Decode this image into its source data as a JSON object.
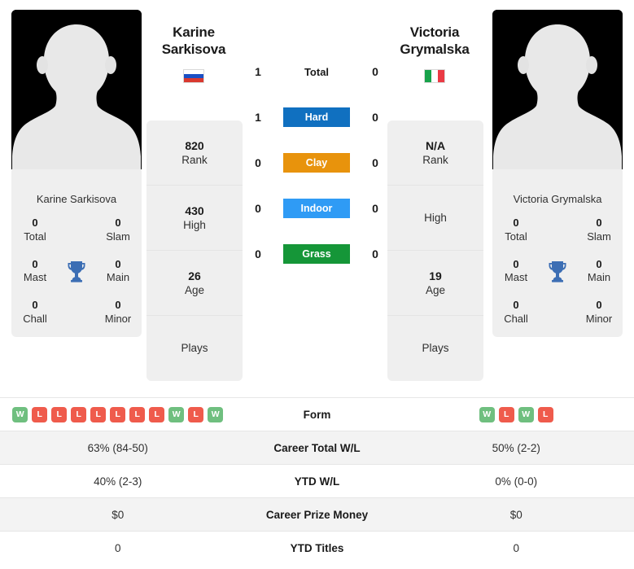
{
  "players": {
    "left": {
      "first_name": "Karine",
      "last_name": "Sarkisova",
      "full_name": "Karine Sarkisova",
      "flag": "ru-flag-icon",
      "avatar": "player-silhouette-icon",
      "rank": "820",
      "rank_label": "Rank",
      "high": "430",
      "high_label": "High",
      "age": "26",
      "age_label": "Age",
      "plays": "",
      "plays_label": "Plays",
      "titles": {
        "total": "0",
        "total_label": "Total",
        "slam": "0",
        "slam_label": "Slam",
        "mast": "0",
        "mast_label": "Mast",
        "main": "0",
        "main_label": "Main",
        "chall": "0",
        "chall_label": "Chall",
        "minor": "0",
        "minor_label": "Minor"
      }
    },
    "right": {
      "first_name": "Victoria",
      "last_name": "Grymalska",
      "full_name": "Victoria Grymalska",
      "flag": "it-flag-icon",
      "avatar": "player-silhouette-icon",
      "rank": "N/A",
      "rank_label": "Rank",
      "high": "",
      "high_label": "High",
      "age": "19",
      "age_label": "Age",
      "plays": "",
      "plays_label": "Plays",
      "titles": {
        "total": "0",
        "total_label": "Total",
        "slam": "0",
        "slam_label": "Slam",
        "mast": "0",
        "mast_label": "Mast",
        "main": "0",
        "main_label": "Main",
        "chall": "0",
        "chall_label": "Chall",
        "minor": "0",
        "minor_label": "Minor"
      }
    }
  },
  "head_to_head": [
    {
      "label": "Total",
      "left": "1",
      "right": "0",
      "color": "",
      "style": "plain"
    },
    {
      "label": "Hard",
      "left": "1",
      "right": "0",
      "color": "#1070c0",
      "style": "badge"
    },
    {
      "label": "Clay",
      "left": "0",
      "right": "0",
      "color": "#e8930c",
      "style": "badge"
    },
    {
      "label": "Indoor",
      "left": "0",
      "right": "0",
      "color": "#2f9bf5",
      "style": "badge"
    },
    {
      "label": "Grass",
      "left": "0",
      "right": "0",
      "color": "#159638",
      "style": "badge"
    }
  ],
  "stats_rows": [
    {
      "label": "Form",
      "type": "form",
      "left_form": [
        "W",
        "L",
        "L",
        "L",
        "L",
        "L",
        "L",
        "L",
        "W",
        "L",
        "W"
      ],
      "right_form": [
        "W",
        "L",
        "W",
        "L"
      ],
      "shaded": false
    },
    {
      "label": "Career Total W/L",
      "type": "text",
      "left": "63% (84-50)",
      "right": "50% (2-2)",
      "shaded": true
    },
    {
      "label": "YTD W/L",
      "type": "text",
      "left": "40% (2-3)",
      "right": "0% (0-0)",
      "shaded": false
    },
    {
      "label": "Career Prize Money",
      "type": "text",
      "left": "$0",
      "right": "$0",
      "shaded": true
    },
    {
      "label": "YTD Titles",
      "type": "text",
      "left": "0",
      "right": "0",
      "shaded": false
    }
  ],
  "colors": {
    "trophy": "#3c6eb4",
    "win": "#6fbf7f",
    "loss": "#ef5b4c",
    "card_bg": "#efefef",
    "row_shade": "#f3f3f3"
  },
  "icons": {
    "trophy": "trophy-icon"
  }
}
